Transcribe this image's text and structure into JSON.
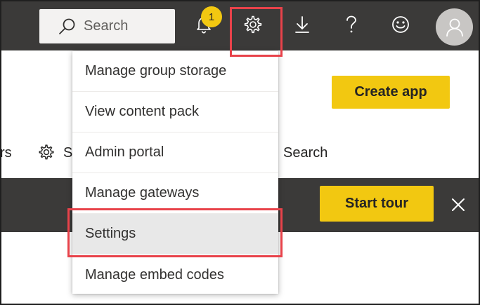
{
  "topbar": {
    "search_placeholder": "Search",
    "notification_count": "1",
    "icons": [
      "search-icon",
      "bell-icon",
      "gear-icon",
      "download-icon",
      "help-icon",
      "smiley-icon",
      "user-icon"
    ]
  },
  "main": {
    "create_app_label": "Create app",
    "toolbar_fragment_left": "rs",
    "toolbar_fragment_mid": "S",
    "toolbar_fragment_search": "Search"
  },
  "tour_banner": {
    "start_tour_label": "Start tour"
  },
  "settings_menu": {
    "items": [
      {
        "label": "Manage group storage"
      },
      {
        "label": "View content pack"
      },
      {
        "label": "Admin portal"
      },
      {
        "label": "Manage gateways"
      },
      {
        "label": "Settings",
        "selected": true
      },
      {
        "label": "Manage embed codes"
      }
    ]
  },
  "colors": {
    "header_bg": "#3b3a39",
    "accent_yellow": "#f2c811",
    "highlight_red": "#e8424a"
  }
}
